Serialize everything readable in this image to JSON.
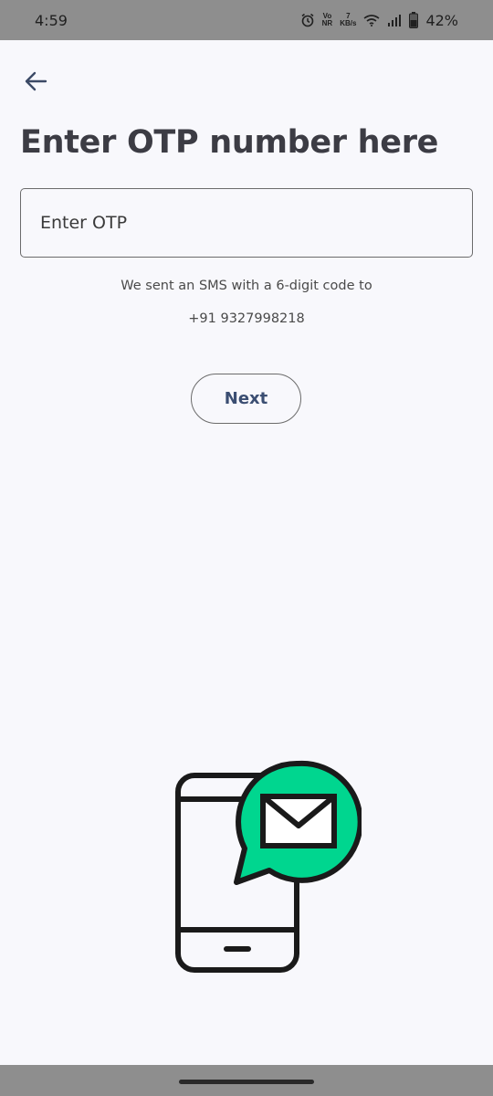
{
  "status_bar": {
    "time": "4:59",
    "network_top": "Vo",
    "network_bottom": "NR",
    "speed_value": "7",
    "speed_unit": "KB/s",
    "battery_pct": "42%",
    "icons": [
      "alarm-icon",
      "volte-icon",
      "wifi-icon",
      "signal-icon",
      "battery-icon"
    ]
  },
  "header": {
    "back_icon": "arrow-left-icon"
  },
  "main": {
    "title": "Enter OTP number here",
    "otp_input": {
      "placeholder": "Enter OTP",
      "value": ""
    },
    "sms_message": "We sent an SMS with a 6-digit code to",
    "phone_number": "+91 9327998218",
    "next_label": "Next"
  },
  "illustration": {
    "name": "phone-sms-illustration",
    "accent_color": "#00d68f",
    "stroke_color": "#1a1a1a"
  },
  "colors": {
    "background": "#f8f8fc",
    "title": "#3c3c44",
    "button_text": "#3b4e72",
    "status_bar": "#8e8e8e"
  }
}
